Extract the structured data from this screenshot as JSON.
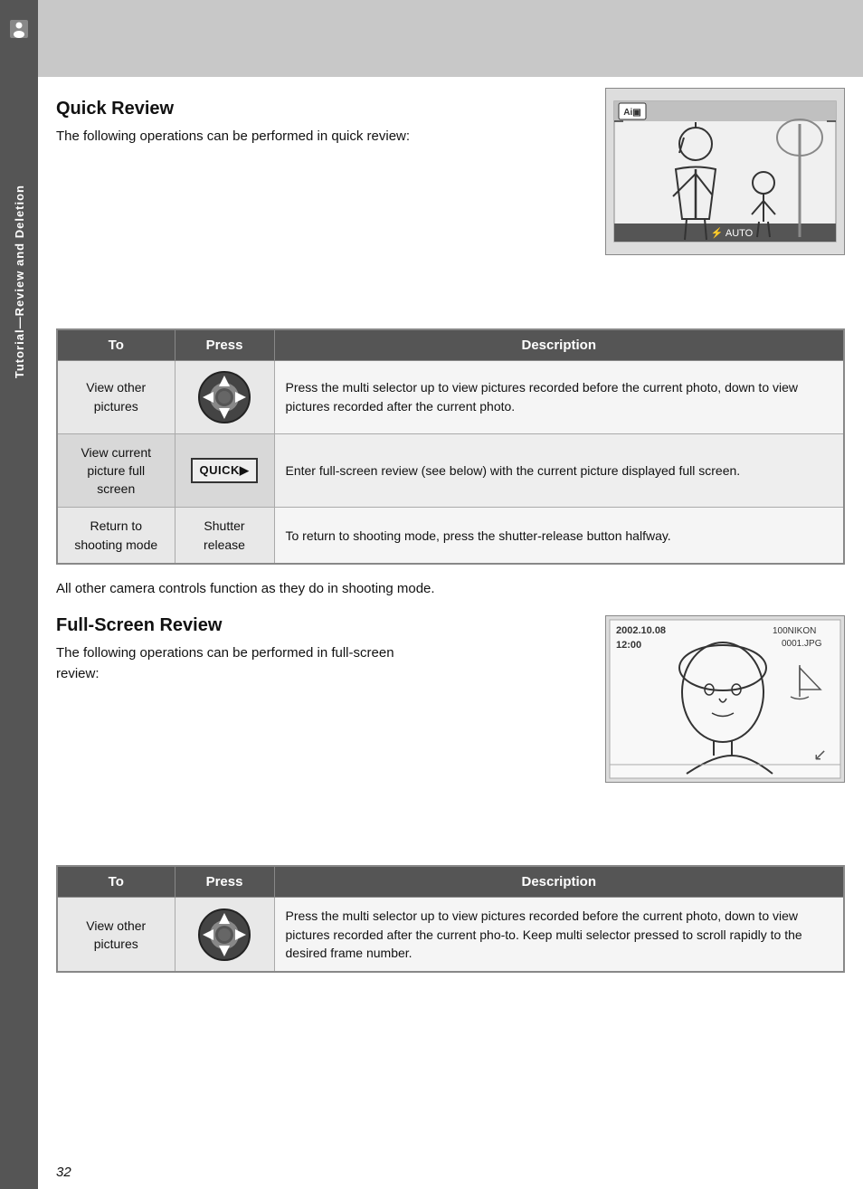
{
  "sidebar": {
    "label": "Tutorial—Review and Deletion",
    "icon": "person-icon"
  },
  "section1": {
    "title": "Quick Review",
    "intro": "The following operations can be performed in quick review:",
    "table": {
      "headers": [
        "To",
        "Press",
        "Description"
      ],
      "rows": [
        {
          "to": "View other pictures",
          "press": "multi-selector",
          "description": "Press the multi selector up to view pictures recorded before the current photo, down to view pictures recorded after the current photo."
        },
        {
          "to": "View current picture full screen",
          "press": "QUICK▶",
          "description": "Enter full-screen review (see below) with the current picture displayed full screen."
        },
        {
          "to": "Return to shooting mode",
          "press": "Shutter release",
          "description": "To return to shooting mode, press the shutter-release button halfway."
        }
      ]
    }
  },
  "between_text": "All other camera controls function as they do in shooting mode.",
  "section2": {
    "title": "Full-Screen Review",
    "intro": "The following operations can be performed in full-screen review:",
    "table": {
      "headers": [
        "To",
        "Press",
        "Description"
      ],
      "rows": [
        {
          "to": "View other pictures",
          "press": "multi-selector",
          "description": "Press the multi selector up to view pictures recorded before the current photo, down to view pictures recorded after the current pho-to.  Keep multi selector pressed to scroll rapidly to the desired frame number."
        }
      ]
    }
  },
  "page_number": "32",
  "camera1": {
    "label": "Camera viewfinder illustration with two people"
  },
  "camera2": {
    "label": "Camera full-screen review illustration with portrait"
  }
}
